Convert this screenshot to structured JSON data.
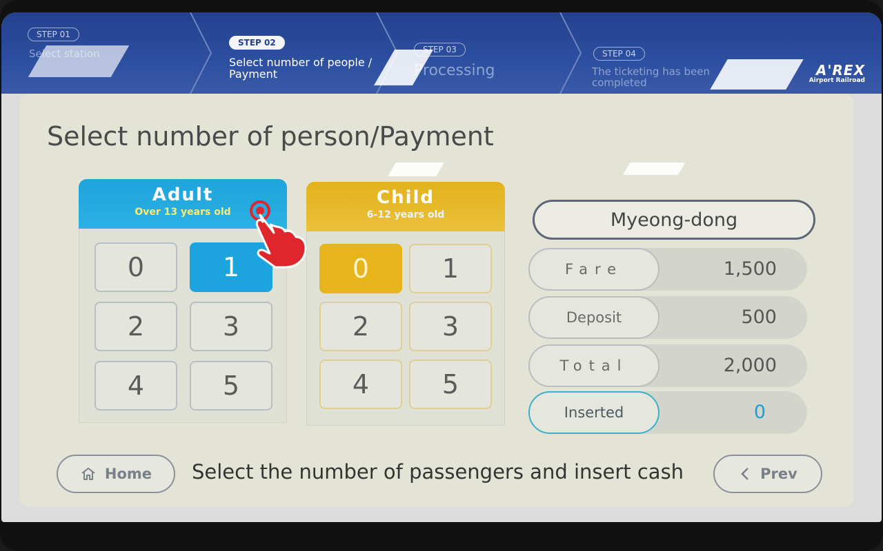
{
  "steps": [
    {
      "chip": "STEP 01",
      "label": "Select station"
    },
    {
      "chip": "STEP 02",
      "label": "Select number of people / Payment"
    },
    {
      "chip": "STEP 03",
      "label": "Processing"
    },
    {
      "chip": "STEP 04",
      "label": "The ticketing has been completed"
    }
  ],
  "logo": {
    "main": "A'REX",
    "sub": "Airport Railroad"
  },
  "page_title": "Select number of person/Payment",
  "adult": {
    "title": "Adult",
    "subtitle": "Over 13 years old",
    "numbers": [
      "0",
      "1",
      "2",
      "3",
      "4",
      "5"
    ],
    "selected": "1"
  },
  "child": {
    "title": "Child",
    "subtitle": "6-12 years old",
    "numbers": [
      "0",
      "1",
      "2",
      "3",
      "4",
      "5"
    ],
    "selected": "0"
  },
  "station": "Myeong-dong",
  "fares": {
    "fare": {
      "label": "Fare",
      "value": "1,500"
    },
    "deposit": {
      "label": "Deposit",
      "value": "500"
    },
    "total": {
      "label": "Total",
      "value": "2,000"
    },
    "inserted": {
      "label": "Inserted",
      "value": "0"
    }
  },
  "footer": {
    "home": "Home",
    "instruction": "Select the number of passengers and insert cash",
    "prev": "Prev"
  },
  "colors": {
    "step_bar": "#2d4fa0",
    "adult_accent": "#1da4de",
    "child_accent": "#e7b51b",
    "inserted_accent": "#1e9ed6"
  },
  "icons": {
    "home": "home-icon",
    "prev": "chevron-left-icon",
    "hand": "pointing-hand-icon"
  }
}
